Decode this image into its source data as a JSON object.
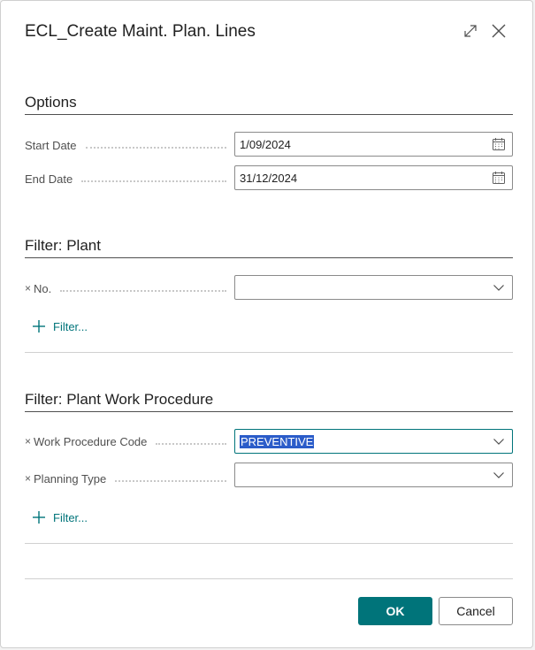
{
  "dialog": {
    "title": "ECL_Create Maint. Plan. Lines"
  },
  "options": {
    "heading": "Options",
    "start_date": {
      "label": "Start Date",
      "value": "1/09/2024"
    },
    "end_date": {
      "label": "End Date",
      "value": "31/12/2024"
    }
  },
  "filter_plant": {
    "heading": "Filter: Plant",
    "no_field": {
      "remove": "×",
      "label": "No.",
      "value": ""
    },
    "add_filter": "Filter..."
  },
  "filter_procedure": {
    "heading": "Filter: Plant Work Procedure",
    "work_procedure_code": {
      "remove": "×",
      "label": "Work Procedure Code",
      "value": "PREVENTIVE"
    },
    "planning_type": {
      "remove": "×",
      "label": "Planning Type",
      "value": ""
    },
    "add_filter": "Filter..."
  },
  "footer": {
    "ok_label": "OK",
    "cancel_label": "Cancel"
  },
  "colors": {
    "accent": "#00747a",
    "selection": "#2b5cc9"
  }
}
